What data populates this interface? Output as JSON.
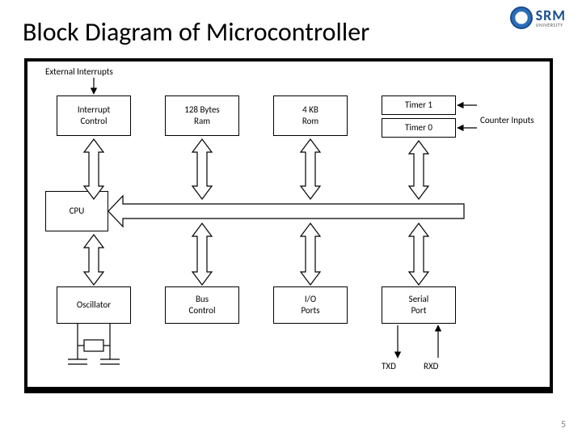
{
  "title": "Block Diagram of Microcontroller",
  "logo": {
    "text": "SRM",
    "sub": "UNIVERSITY"
  },
  "slide_number": "5",
  "labels": {
    "external_interrupts": "External Interrupts",
    "counter_inputs": "Counter Inputs",
    "txd": "TXD",
    "rxd": "RXD"
  },
  "blocks": {
    "interrupt": "Interrupt\nControl",
    "ram": "128 Bytes\nRam",
    "rom": "4 KB\nRom",
    "timer1": "Timer 1",
    "timer0": "Timer 0",
    "cpu": "CPU",
    "osc": "Oscillator",
    "bus": "Bus\nControl",
    "io": "I/O\nPorts",
    "serial": "Serial\nPort"
  }
}
